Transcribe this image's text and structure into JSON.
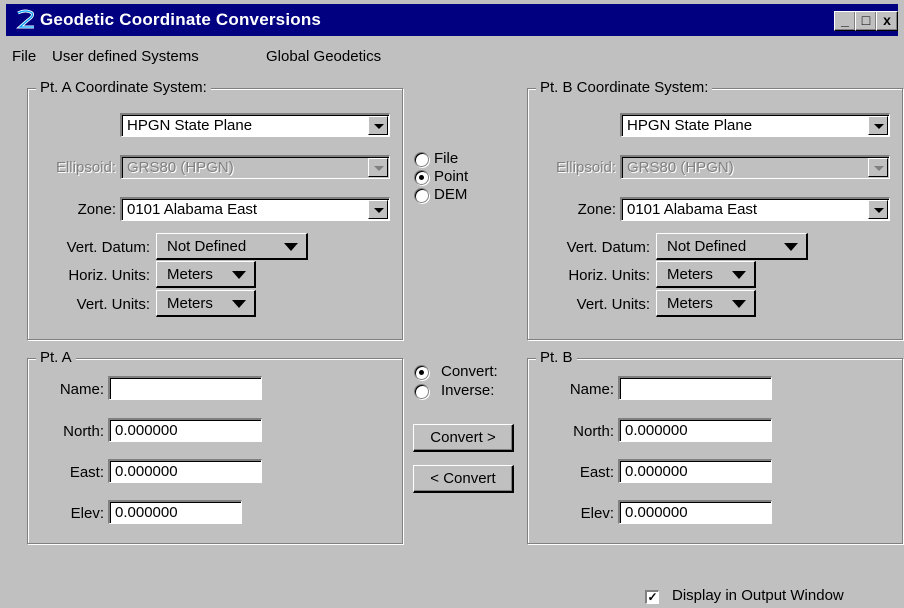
{
  "window": {
    "title": "Geodetic Coordinate Conversions",
    "minimize": "_",
    "maximize": "□",
    "close": "x"
  },
  "menu": [
    "File",
    "User defined Systems",
    "Global Geodetics"
  ],
  "pt_a_system": {
    "legend": "Pt. A Coordinate System:",
    "system": "HPGN State Plane",
    "ellipsoid_label": "Ellipsoid:",
    "ellipsoid": "GRS80 (HPGN)",
    "zone_label": "Zone:",
    "zone": "0101 Alabama East",
    "vert_datum_label": "Vert. Datum:",
    "vert_datum": "Not Defined",
    "horiz_units_label": "Horiz. Units:",
    "horiz_units": "Meters",
    "vert_units_label": "Vert. Units:",
    "vert_units": "Meters"
  },
  "pt_b_system": {
    "legend": "Pt. B Coordinate System:",
    "system": "HPGN State Plane",
    "ellipsoid_label": "Ellipsoid:",
    "ellipsoid": "GRS80 (HPGN)",
    "zone_label": "Zone:",
    "zone": "0101 Alabama East",
    "vert_datum_label": "Vert. Datum:",
    "vert_datum": "Not Defined",
    "horiz_units_label": "Horiz. Units:",
    "horiz_units": "Meters",
    "vert_units_label": "Vert. Units:",
    "vert_units": "Meters"
  },
  "mode": {
    "options": [
      "File",
      "Point",
      "DEM"
    ],
    "selected": "Point"
  },
  "direction": {
    "options": [
      "Convert:",
      "Inverse:"
    ],
    "selected": "Convert:"
  },
  "pt_a": {
    "legend": "Pt. A",
    "name_label": "Name:",
    "name": "",
    "north_label": "North:",
    "north": "0.000000",
    "east_label": "East:",
    "east": "0.000000",
    "elev_label": "Elev:",
    "elev": "0.000000"
  },
  "pt_b": {
    "legend": "Pt. B",
    "name_label": "Name:",
    "name": "",
    "north_label": "North:",
    "north": "0.000000",
    "east_label": "East:",
    "east": "0.000000",
    "elev_label": "Elev:",
    "elev": "0.000000"
  },
  "buttons": {
    "convert_forward": "Convert >",
    "convert_back": "< Convert"
  },
  "display_output": {
    "label": "Display in Output Window",
    "checked": true,
    "mark": "✓"
  },
  "colors": {
    "titlebar": "#000080",
    "face": "#c0c0c0",
    "disabled_text": "#808080"
  }
}
